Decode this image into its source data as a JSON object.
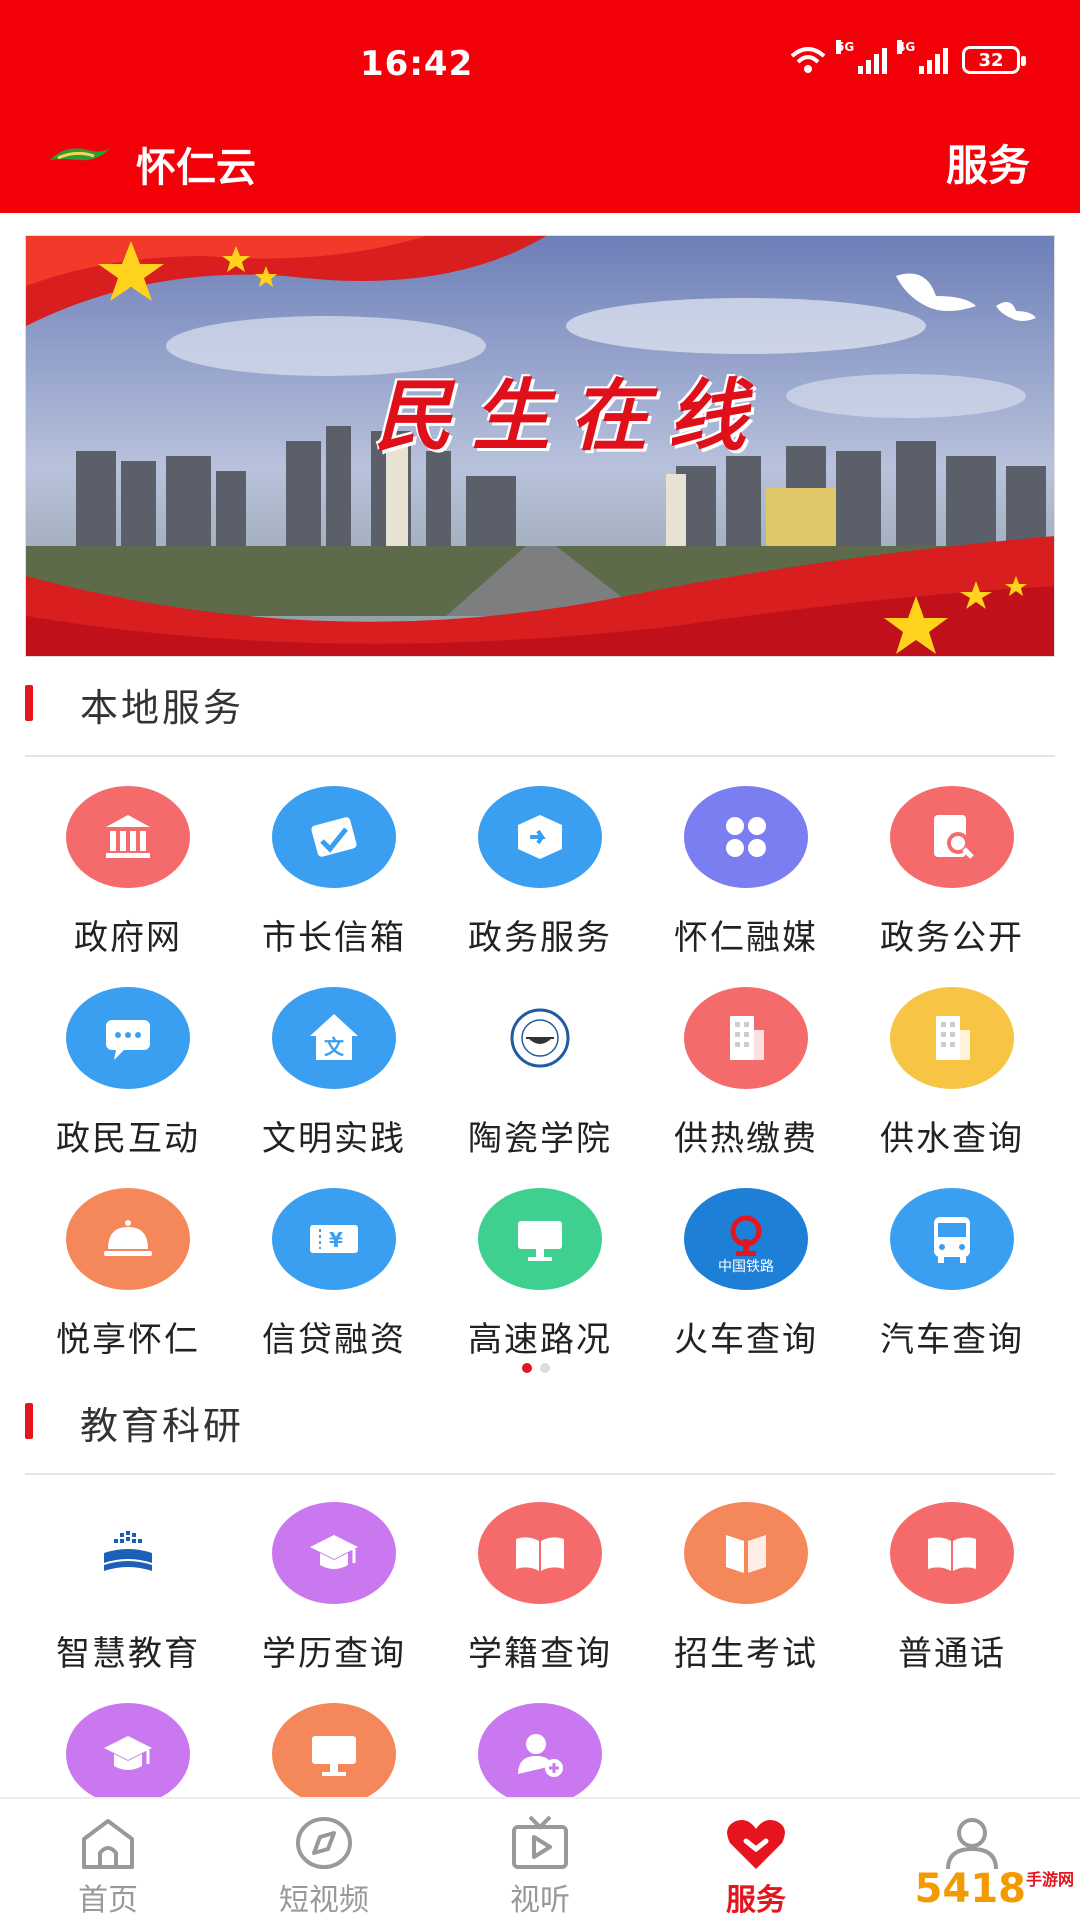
{
  "status_bar": {
    "time": "16:42",
    "net1": "5G",
    "net2": "4G",
    "battery": "32"
  },
  "header": {
    "app_name": "怀仁云",
    "page_name": "服务"
  },
  "banner": {
    "title": "民生在线"
  },
  "sections": [
    {
      "title": "本地服务",
      "items": [
        {
          "label": "政府网",
          "icon": "government-building-icon",
          "color": "#f56a6a"
        },
        {
          "label": "市长信箱",
          "icon": "mail-check-icon",
          "color": "#3a9ff0"
        },
        {
          "label": "政务服务",
          "icon": "box-arrow-icon",
          "color": "#3a9ff0"
        },
        {
          "label": "怀仁融媒",
          "icon": "grid-four-icon",
          "color": "#7a7ef0"
        },
        {
          "label": "政务公开",
          "icon": "document-search-icon",
          "color": "#f56a6a"
        },
        {
          "label": "政民互动",
          "icon": "chat-bubble-icon",
          "color": "#3a9ff0"
        },
        {
          "label": "文明实践",
          "icon": "house-wen-icon",
          "color": "#3a9ff0"
        },
        {
          "label": "陶瓷学院",
          "icon": "college-seal-icon",
          "color": "#ffffff"
        },
        {
          "label": "供热缴费",
          "icon": "building-icon",
          "color": "#f56a6a"
        },
        {
          "label": "供水查询",
          "icon": "building-icon",
          "color": "#f7c543"
        },
        {
          "label": "悦享怀仁",
          "icon": "food-cloche-icon",
          "color": "#f5885a"
        },
        {
          "label": "信贷融资",
          "icon": "yen-ticket-icon",
          "color": "#3a9ff0"
        },
        {
          "label": "高速路况",
          "icon": "monitor-icon",
          "color": "#3fcf8e"
        },
        {
          "label": "火车查询",
          "icon": "china-railway-icon",
          "color": "#1e7fd6",
          "sublabel": "中国铁路"
        },
        {
          "label": "汽车查询",
          "icon": "bus-icon",
          "color": "#3a9ff0"
        }
      ]
    },
    {
      "title": "教育科研",
      "items": [
        {
          "label": "智慧教育",
          "icon": "smart-education-logo-icon",
          "color": "#ffffff"
        },
        {
          "label": "学历查询",
          "icon": "graduation-cap-icon",
          "color": "#c978f0"
        },
        {
          "label": "学籍查询",
          "icon": "open-book-icon",
          "color": "#f56a6a"
        },
        {
          "label": "招生考试",
          "icon": "book-icon",
          "color": "#f5885a"
        },
        {
          "label": "普通话",
          "icon": "open-book-icon",
          "color": "#f56a6a"
        },
        {
          "label": "",
          "icon": "graduation-cap-icon",
          "color": "#c978f0"
        },
        {
          "label": "",
          "icon": "monitor-icon",
          "color": "#f5885a"
        },
        {
          "label": "",
          "icon": "user-add-icon",
          "color": "#c978f0"
        }
      ]
    }
  ],
  "bottom_nav": [
    {
      "label": "首页",
      "icon": "home-icon",
      "active": false
    },
    {
      "label": "短视频",
      "icon": "compass-icon",
      "active": false
    },
    {
      "label": "视听",
      "icon": "tv-play-icon",
      "active": false
    },
    {
      "label": "服务",
      "icon": "heart-icon",
      "active": true
    },
    {
      "label": "",
      "icon": "user-icon",
      "active": false
    }
  ],
  "watermark": {
    "text": "5418",
    "sub": "手游网"
  }
}
